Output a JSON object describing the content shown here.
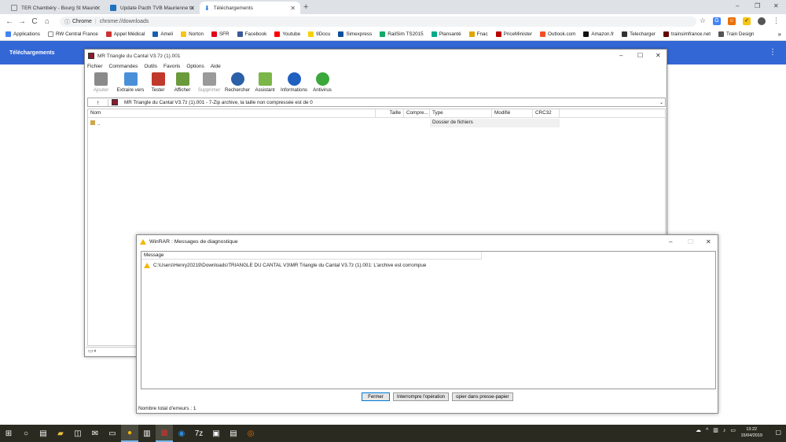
{
  "browser": {
    "tabs": [
      {
        "title": "TER Chambéry - Bourg St Mauric",
        "color": "#888"
      },
      {
        "title": "Update Pacth TVB Maurienne ta",
        "color": "#1e73be"
      },
      {
        "title": "Téléchargements",
        "color": "#1a73e8"
      }
    ],
    "newtab": "+",
    "win_min": "–",
    "win_max": "❐",
    "win_close": "✕",
    "back": "←",
    "forward": "→",
    "reload": "C",
    "home": "⌂",
    "omni_site": "Chrome",
    "omni_url": "chrome://downloads",
    "star": "☆",
    "bookmarks": [
      {
        "label": "Applications",
        "color": "#4285f4"
      },
      {
        "label": "RW Central France",
        "color": "#888"
      },
      {
        "label": "Appel Médical",
        "color": "#c33"
      },
      {
        "label": "Ameli",
        "color": "#1a5fb4"
      },
      {
        "label": "Norton",
        "color": "#f5c518"
      },
      {
        "label": "SFR",
        "color": "#e2001a"
      },
      {
        "label": "Facebook",
        "color": "#3b5998"
      },
      {
        "label": "Youtube",
        "color": "#f00"
      },
      {
        "label": "9Docu",
        "color": "#f7d100"
      },
      {
        "label": "Simexpress",
        "color": "#0b4f9c"
      },
      {
        "label": "RailSim TS2015",
        "color": "#1a6"
      },
      {
        "label": "Plansanté",
        "color": "#0a8"
      },
      {
        "label": "Fnac",
        "color": "#e1a500"
      },
      {
        "label": "PriceMinister",
        "color": "#b00"
      },
      {
        "label": "Outlook.com",
        "color": "#f25022"
      },
      {
        "label": "Amazon.fr",
        "color": "#111"
      },
      {
        "label": "Telecharger",
        "color": "#333"
      },
      {
        "label": "trainsimfrance.net",
        "color": "#600"
      },
      {
        "label": "Train Design",
        "color": "#555"
      }
    ],
    "bm_more": "»",
    "downloads_title": "Téléchargements",
    "menu_dots": "⋮"
  },
  "winrar": {
    "title": "MR Triangle du Cantal V3.7z (1).001",
    "menu": [
      "Fichier",
      "Commandes",
      "Outils",
      "Favoris",
      "Options",
      "Aide"
    ],
    "tools": [
      {
        "label": "Ajouter",
        "color": "#8a8a8a",
        "disabled": true
      },
      {
        "label": "Extraire vers",
        "color": "#4a90d9",
        "disabled": false
      },
      {
        "label": "Tester",
        "color": "#c0392b",
        "disabled": false
      },
      {
        "label": "Afficher",
        "color": "#6a9a3a",
        "disabled": false
      },
      {
        "label": "Supprimer",
        "color": "#9a9a9a",
        "disabled": true
      },
      {
        "label": "Rechercher",
        "color": "#2b5fa8",
        "disabled": false
      },
      {
        "label": "Assistant",
        "color": "#7ab648",
        "disabled": false
      },
      {
        "label": "Informations",
        "color": "#2060c0",
        "disabled": false
      },
      {
        "label": "Antivirus",
        "color": "#3aa83a",
        "disabled": false
      }
    ],
    "up": "↑",
    "path": "MR Triangle du Cantal V3.7z (1).001 - 7-Zip archive, la taille non compressée est de 0",
    "columns": [
      "Nom",
      "Taille",
      "Compre...",
      "Type",
      "Modifié",
      "CRC32"
    ],
    "rows": [
      {
        "name": "..",
        "type": "Dossier de fichiers"
      }
    ]
  },
  "diag": {
    "title": "WinRAR : Messages de diagnostique",
    "col": "Message",
    "message": "C:\\Users\\Henry20219\\Downloads\\TRIANGLE DU CANTAL V3\\MR Triangle du Cantal V3.7z (1).001: L'archive est corrompue",
    "buttons": [
      "Fermer",
      "Interrompre l'opération",
      "opier dans presse-papier"
    ],
    "status": "Nombre total d'erreurs : 1"
  },
  "taskbar": {
    "time": "13:22",
    "date": "15/04/2019"
  }
}
